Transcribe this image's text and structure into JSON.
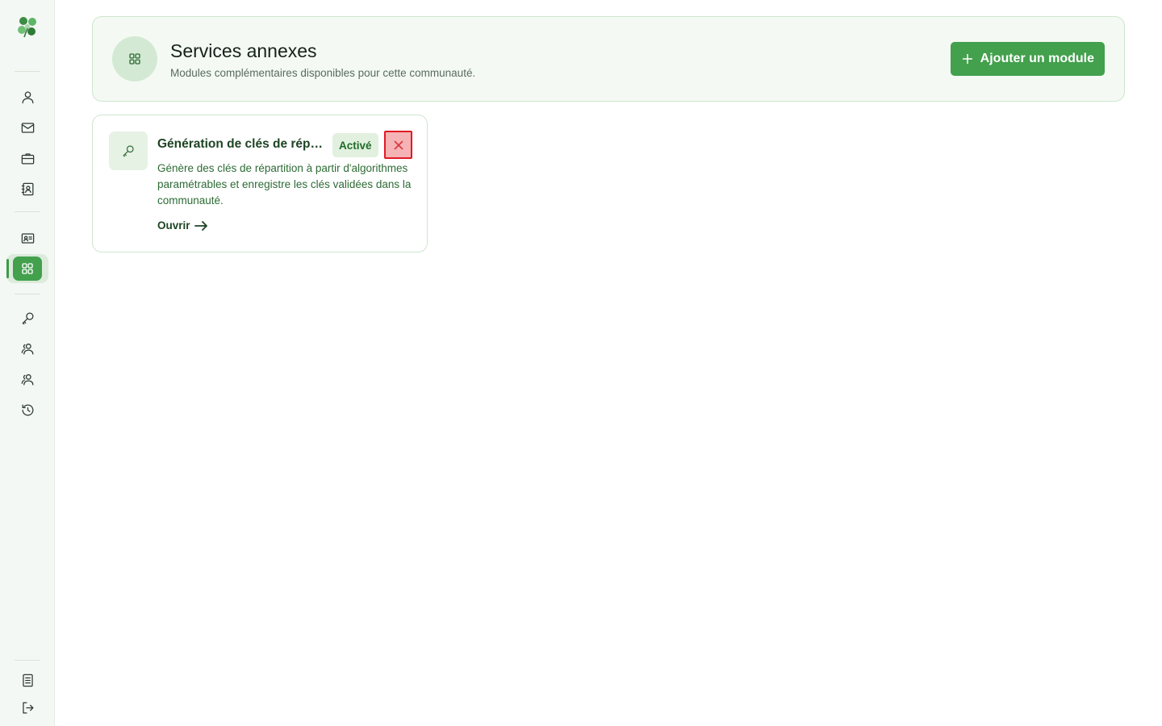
{
  "sidebar": {
    "logo": "clover-logo",
    "items": [
      {
        "icon": "user-icon"
      },
      {
        "icon": "mail-icon"
      },
      {
        "icon": "briefcase-icon"
      },
      {
        "icon": "contact-book-icon"
      },
      {
        "icon": "id-card-icon"
      },
      {
        "icon": "grid-icon",
        "active": true
      },
      {
        "icon": "key-icon"
      },
      {
        "icon": "users-icon"
      },
      {
        "icon": "users-icon"
      },
      {
        "icon": "history-icon"
      }
    ],
    "footer": [
      {
        "icon": "document-icon"
      },
      {
        "icon": "logout-icon"
      }
    ]
  },
  "header": {
    "title": "Services annexes",
    "subtitle": "Modules complémentaires disponibles pour cette communauté.",
    "add_button_label": "Ajouter un module"
  },
  "modules": [
    {
      "title": "Génération de clés de répartition",
      "status": "Activé",
      "description": "Génère des clés de répartition à partir d'algorithmes paramétrables et enregistre les clés validées dans la communauté.",
      "open_label": "Ouvrir"
    }
  ],
  "colors": {
    "accent": "#43a04d",
    "card_border": "#cfe5cf",
    "danger": "#e01b24"
  }
}
